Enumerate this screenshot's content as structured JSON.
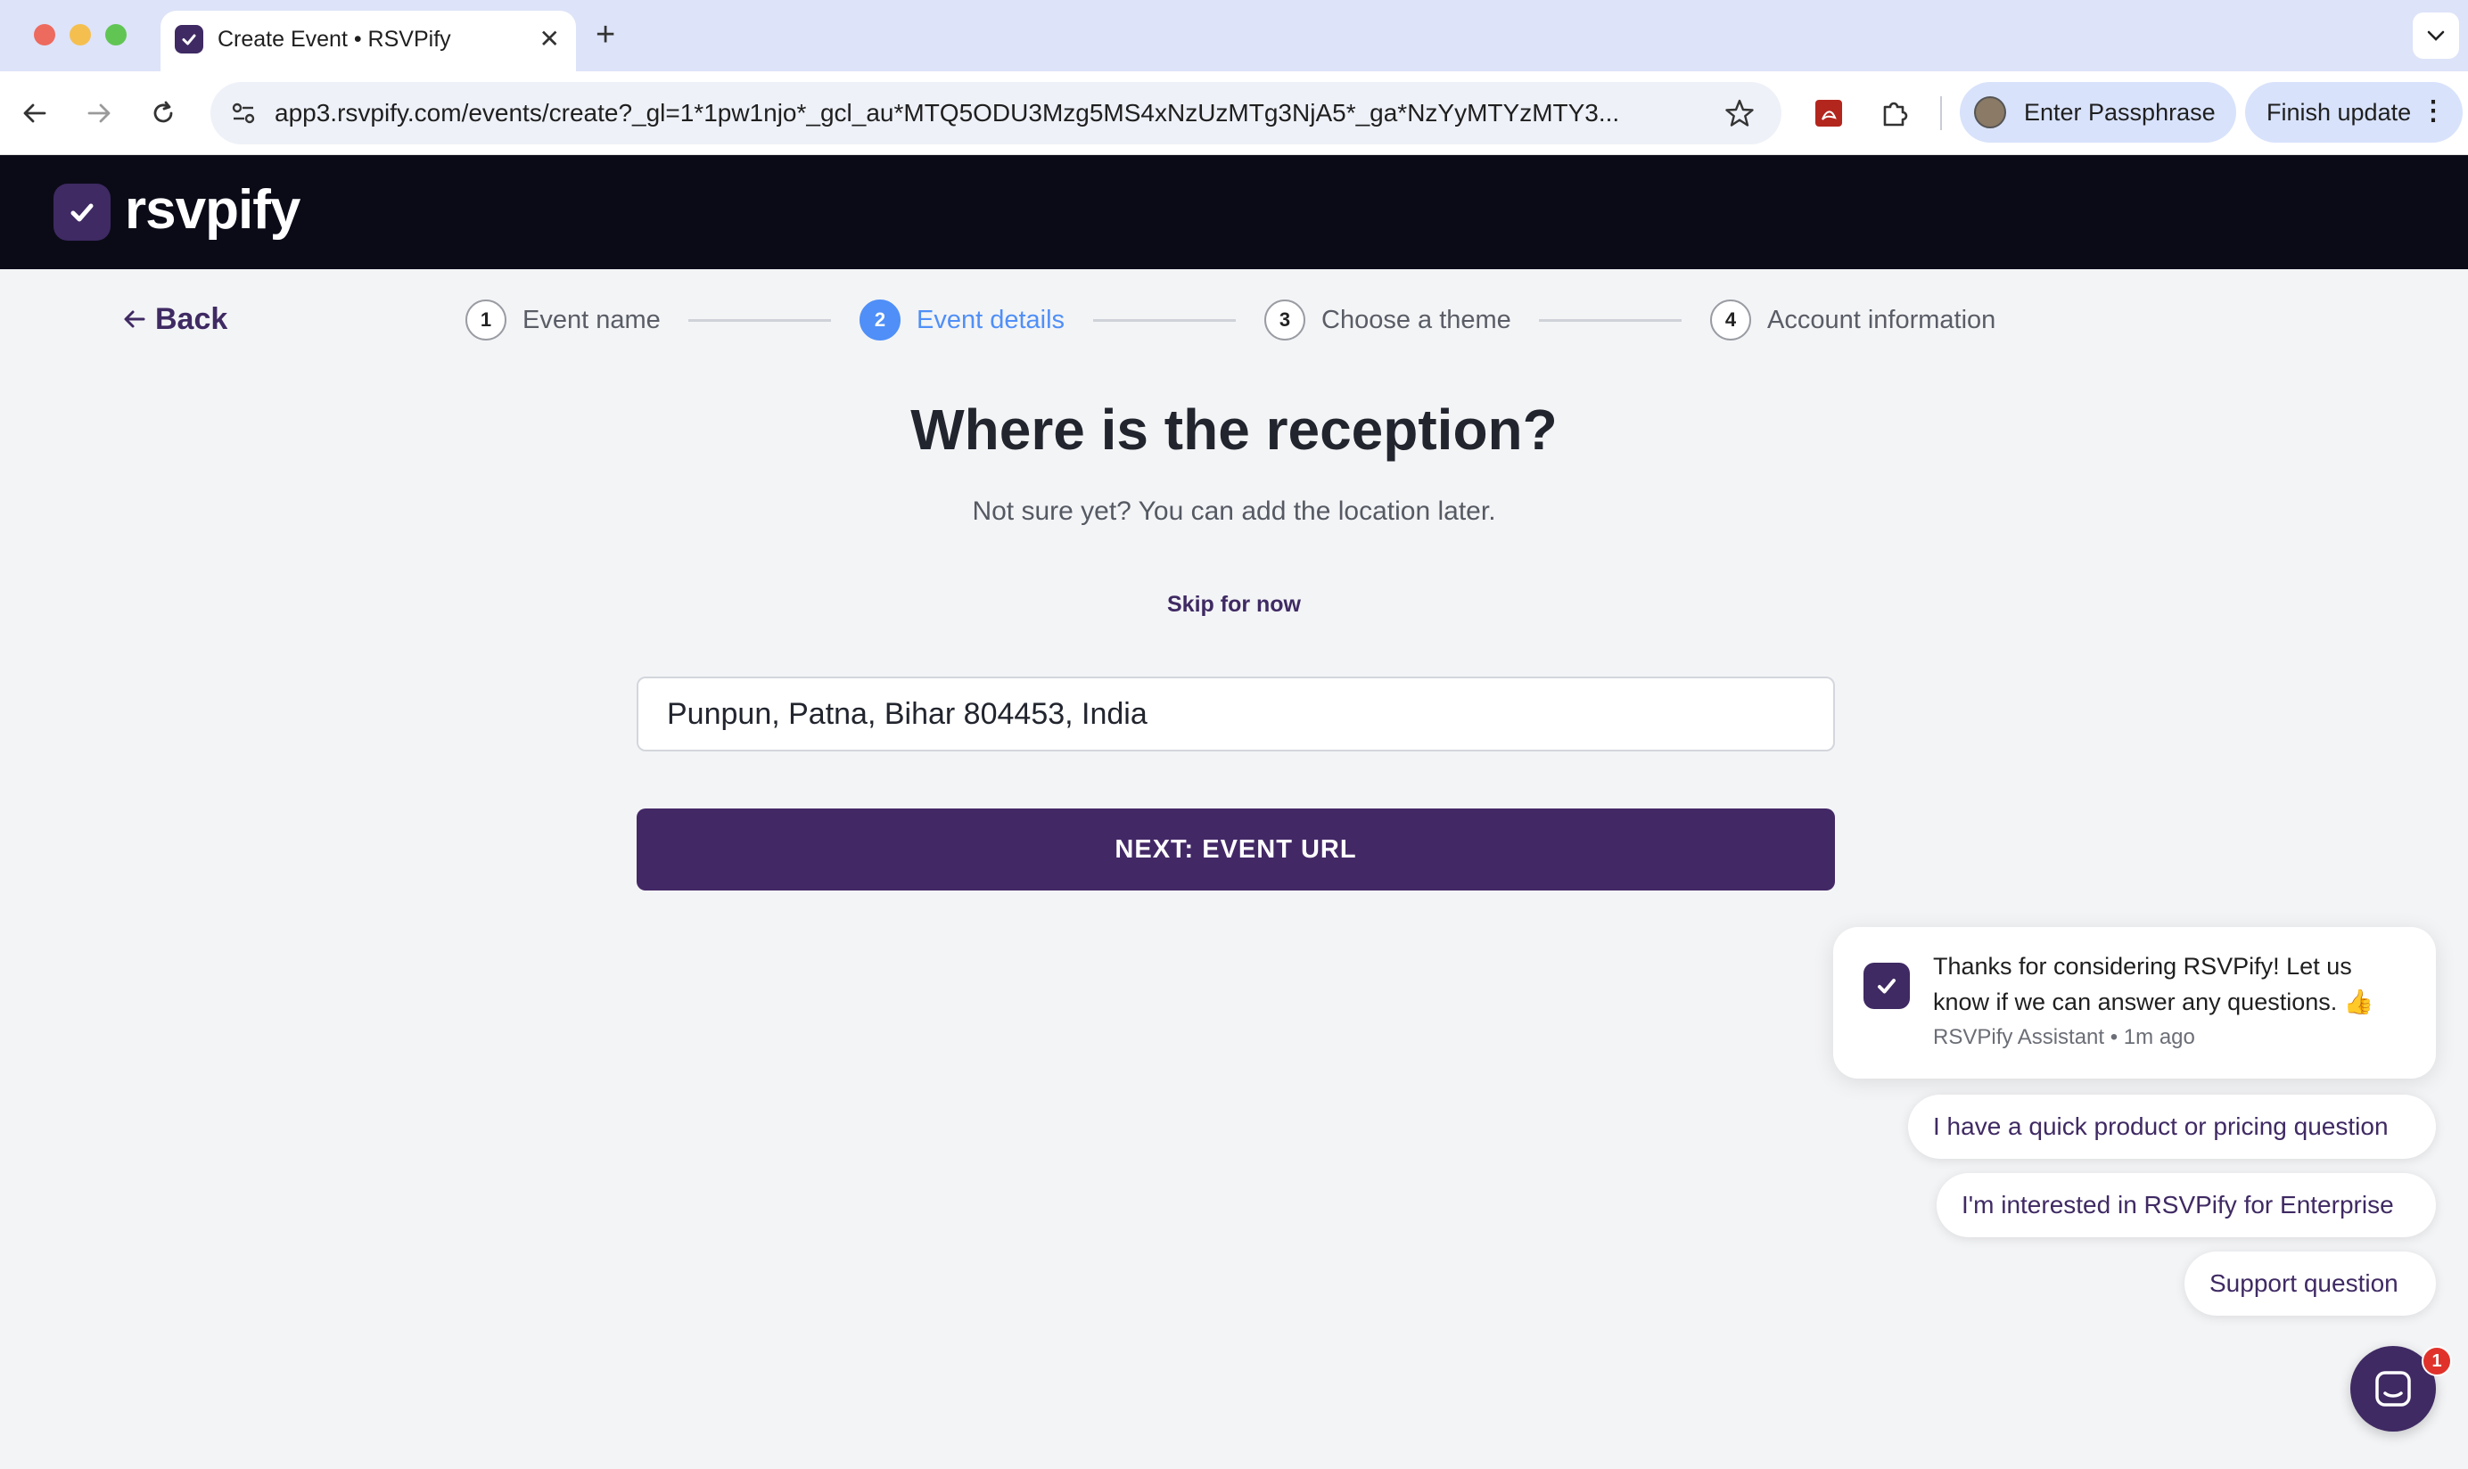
{
  "browser": {
    "tab_title": "Create Event • RSVPify",
    "new_tab_glyph": "+",
    "close_glyph": "✕",
    "url": "app3.rsvpify.com/events/create?_gl=1*1pw1njo*_gcl_au*MTQ5ODU3Mzg5MS4xNzUzMTg3NjA5*_ga*NzYyMTYzMTY3...",
    "profile_label": "Enter Passphrase",
    "update_label": "Finish update",
    "update_menu_glyph": "⋮"
  },
  "app": {
    "logo_text": "rsvpify"
  },
  "steps": {
    "back_label": "Back",
    "items": [
      {
        "num": "1",
        "label": "Event name"
      },
      {
        "num": "2",
        "label": "Event details"
      },
      {
        "num": "3",
        "label": "Choose a theme"
      },
      {
        "num": "4",
        "label": "Account information"
      }
    ],
    "active_step": 2
  },
  "main": {
    "heading": "Where is the reception?",
    "subheading": "Not sure yet? You can add the location later.",
    "skip_label": "Skip for now",
    "location_value": "Punpun, Patna, Bihar 804453, India",
    "next_button": "NEXT: EVENT URL"
  },
  "chat": {
    "message": "Thanks for considering RSVPify! Let us know if we can answer any questions. 👍",
    "meta": "RSVPify Assistant • 1m ago",
    "quick_replies": [
      "I have a quick product or pricing question",
      "I'm interested in RSVPify for Enterprise",
      "Support question"
    ],
    "unread_count": "1"
  },
  "colors": {
    "brand_purple": "#432866",
    "step_active_blue": "#4f8ff7",
    "header_black": "#0b0b18",
    "badge_red": "#e0322b"
  },
  "icons": [
    "back-arrow-icon",
    "forward-arrow-icon",
    "reload-icon",
    "site-settings-icon",
    "bookmark-star-icon",
    "pdf-extension-icon",
    "extensions-puzzle-icon",
    "checkmark-icon",
    "chat-launcher-icon",
    "arrow-left-icon",
    "chevron-down-icon"
  ]
}
